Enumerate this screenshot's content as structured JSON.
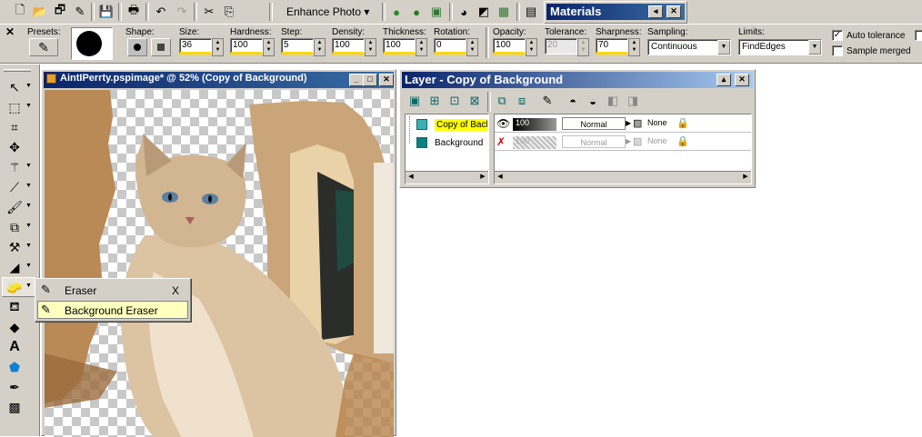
{
  "toolbar": {
    "enhance_photo_label": "Enhance Photo ▾"
  },
  "materials": {
    "title": "Materials"
  },
  "tool_options": {
    "presets_label": "Presets:",
    "shape_label": "Shape:",
    "size_label": "Size:",
    "size_value": "36",
    "hardness_label": "Hardness:",
    "hardness_value": "100",
    "step_label": "Step:",
    "step_value": "5",
    "density_label": "Density:",
    "density_value": "100",
    "thickness_label": "Thickness:",
    "thickness_value": "100",
    "rotation_label": "Rotation:",
    "rotation_value": "0",
    "opacity_label": "Opacity:",
    "opacity_value": "100",
    "tolerance_label": "Tolerance:",
    "tolerance_value": "20",
    "sharpness_label": "Sharpness:",
    "sharpness_value": "70",
    "sampling_label": "Sampling:",
    "sampling_value": "Continuous",
    "limits_label": "Limits:",
    "limits_value": "FindEdges",
    "auto_tolerance_label": "Auto tolerance",
    "auto_tolerance_checked": true,
    "sample_merged_label": "Sample merged",
    "sample_merged_checked": false
  },
  "image_window": {
    "title": "AintIPerrty.pspimage* @  52% (Copy of Background)"
  },
  "flyout": {
    "items": [
      {
        "label": "Eraser",
        "shortcut": "X"
      },
      {
        "label": "Background Eraser",
        "shortcut": ""
      }
    ]
  },
  "layers_palette": {
    "title": "Layer - Copy of Background",
    "layers": [
      {
        "name": "Copy of Back",
        "opacity": "100",
        "blend": "Normal",
        "mask": "None"
      },
      {
        "name": "Background",
        "opacity": "100",
        "blend": "Normal",
        "mask": "None"
      }
    ]
  }
}
